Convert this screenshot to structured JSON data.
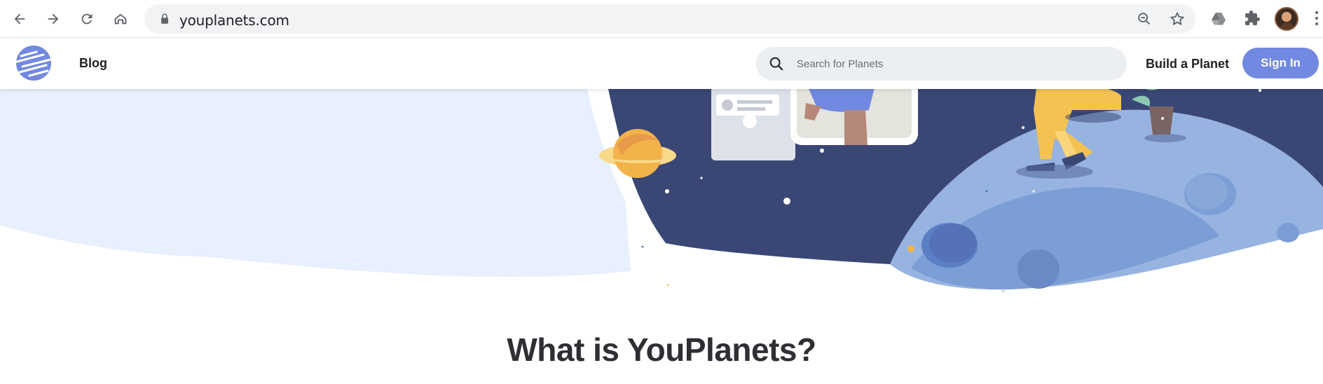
{
  "browser": {
    "url": "youplanets.com",
    "nav_icons": [
      "back-arrow-icon",
      "forward-arrow-icon",
      "reload-icon",
      "home-icon"
    ],
    "omnibox_icons": [
      "lock-icon",
      "zoom-out-icon",
      "star-icon"
    ],
    "extension_icons": [
      "google-drive-icon",
      "puzzle-icon"
    ]
  },
  "header": {
    "blog_label": "Blog",
    "search_placeholder": "Search for Planets",
    "build_label": "Build a Planet",
    "signin_label": "Sign In"
  },
  "main": {
    "section_title": "What is YouPlanets?"
  },
  "colors": {
    "brand": "#7189e0",
    "hero_bg_light": "#e8effd",
    "space_dark": "#3a4775",
    "planet_blue": "#7b9ed6"
  }
}
